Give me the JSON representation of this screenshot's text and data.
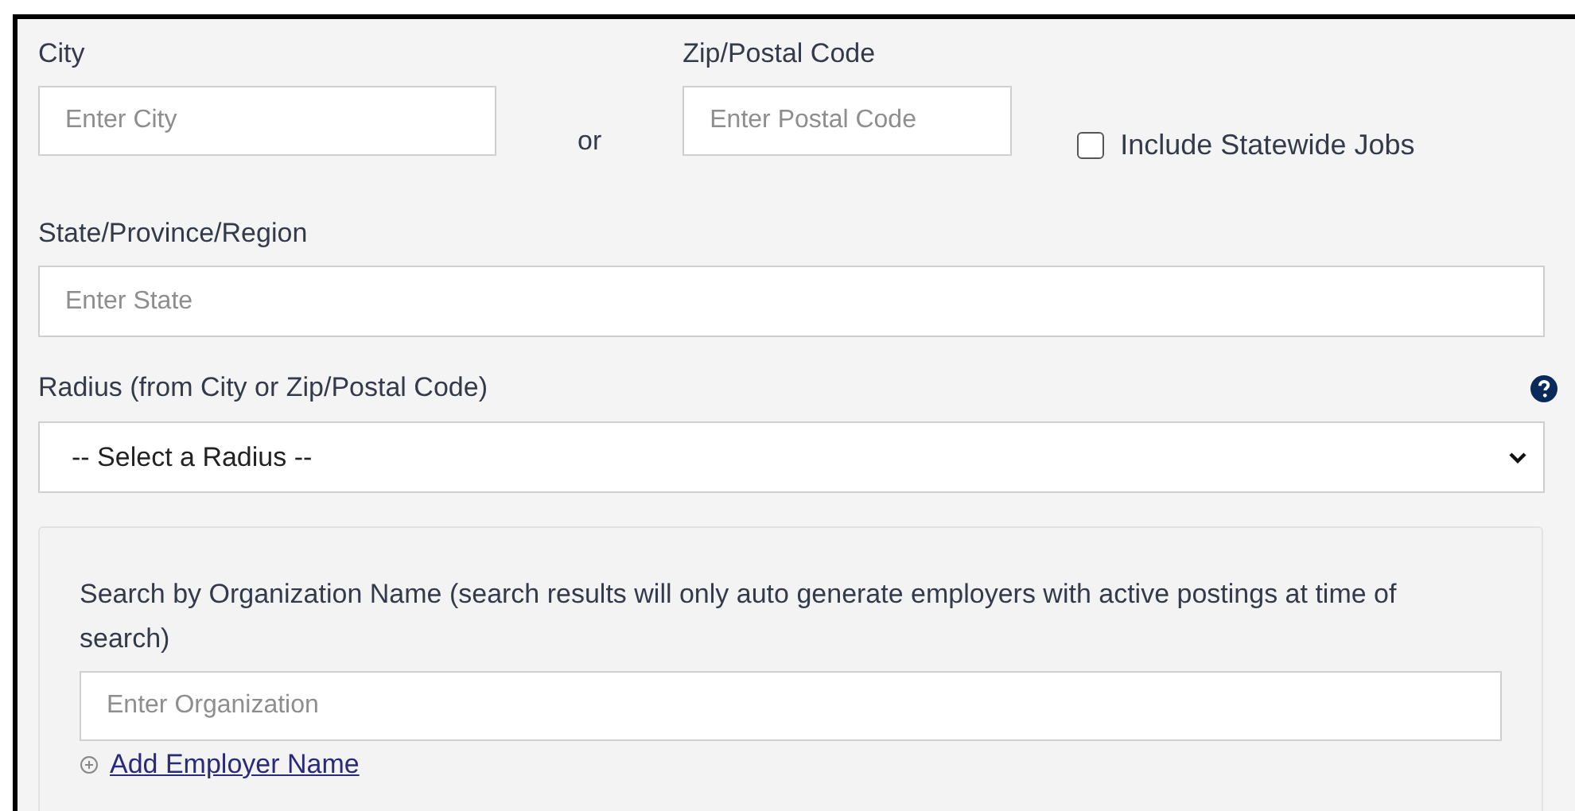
{
  "city": {
    "label": "City",
    "placeholder": "Enter City"
  },
  "separator": "or",
  "postal_code": {
    "label": "Zip/Postal Code",
    "placeholder": "Enter Postal Code"
  },
  "statewide": {
    "label": "Include Statewide Jobs",
    "checked": false
  },
  "state": {
    "label": "State/Province/Region",
    "placeholder": "Enter State"
  },
  "radius": {
    "label": "Radius (from City or Zip/Postal Code)",
    "value": "-- Select a Radius --"
  },
  "organization": {
    "label": "Search by Organization Name (search results will only auto generate employers with active postings at time of search)",
    "placeholder": "Enter Organization",
    "add_link": "Add Employer Name"
  }
}
